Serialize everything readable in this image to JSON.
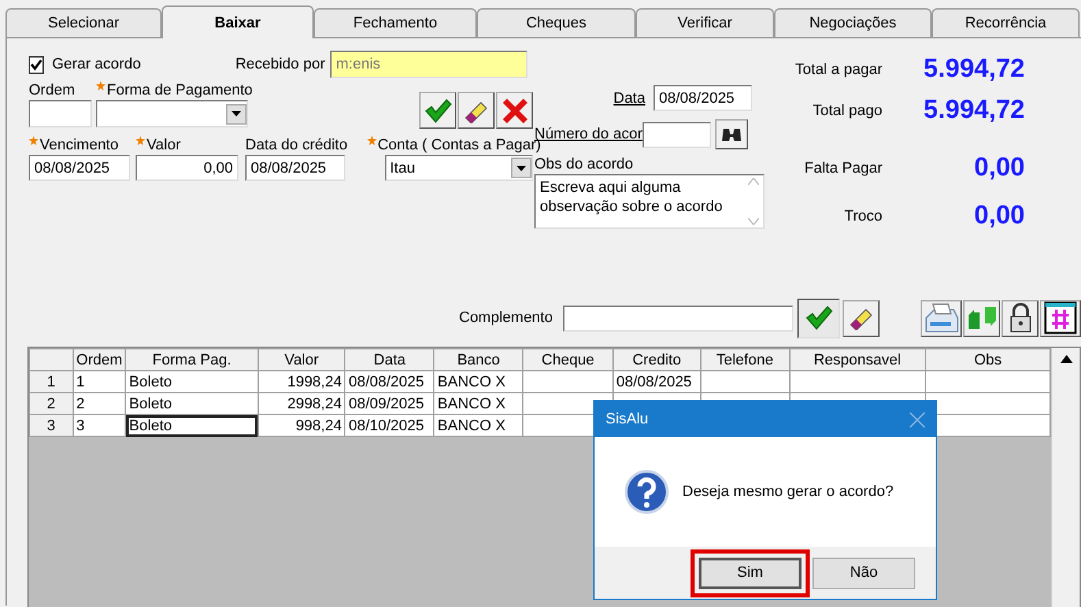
{
  "tabs": [
    {
      "label": "Selecionar",
      "selected": false
    },
    {
      "label": "Baixar",
      "selected": true
    },
    {
      "label": "Fechamento",
      "selected": false
    },
    {
      "label": "Cheques",
      "selected": false
    },
    {
      "label": "Verificar",
      "selected": false
    },
    {
      "label": "Negociações",
      "selected": false
    },
    {
      "label": "Recorrência",
      "selected": false
    }
  ],
  "gerar_acordo": {
    "label": "Gerar acordo",
    "checked": true
  },
  "recebido_por": {
    "label": "Recebido por",
    "value": "m:enis"
  },
  "ordem": {
    "label": "Ordem",
    "required": false
  },
  "forma_pagamento": {
    "label": "Forma de Pagamento",
    "required": true
  },
  "vencimento": {
    "label": "Vencimento",
    "required": true,
    "value": "08/08/2025"
  },
  "valor": {
    "label": "Valor",
    "required": true,
    "value": "0,00"
  },
  "data_credito": {
    "label": "Data do crédito",
    "required": false,
    "value": "08/08/2025"
  },
  "conta": {
    "label": "Conta ( Contas a Pagar)",
    "required": true,
    "value": "Itau"
  },
  "data": {
    "label": "Data",
    "value": "08/08/2025"
  },
  "numero_acordo": {
    "label": "Número do acor"
  },
  "obs_acordo": {
    "label": "Obs do acordo",
    "value": "Escreva aqui alguma observação sobre o acordo"
  },
  "totals": [
    {
      "label": "Total a pagar",
      "value": "5.994,72"
    },
    {
      "label": "Total pago",
      "value": "5.994,72"
    },
    {
      "label": "Falta Pagar",
      "value": "0,00"
    },
    {
      "label": "Troco",
      "value": "0,00"
    }
  ],
  "complemento": {
    "label": "Complemento"
  },
  "table": {
    "columns": [
      "Ordem",
      "Forma Pag.",
      "Valor",
      "Data",
      "Banco",
      "Cheque",
      "Credito",
      "Telefone",
      "Responsavel",
      "Obs"
    ],
    "rows": [
      {
        "number": "1",
        "cells": [
          "1",
          "Boleto",
          "1998,24",
          "08/08/2025",
          "BANCO X",
          "",
          "08/08/2025",
          "",
          "",
          ""
        ],
        "selected": false
      },
      {
        "number": "2",
        "cells": [
          "2",
          "Boleto",
          "2998,24",
          "08/09/2025",
          "BANCO X",
          "",
          "",
          "",
          "",
          ""
        ],
        "selected": false
      },
      {
        "number": "3",
        "cells": [
          "3",
          "Boleto",
          "998,24",
          "08/10/2025",
          "BANCO X",
          "",
          "",
          "",
          "",
          ""
        ],
        "selected": true
      }
    ]
  },
  "dialog": {
    "title": "SisAlu",
    "message": "Deseja mesmo gerar o acordo?",
    "buttons": [
      {
        "label": "Sim",
        "highlighted": true
      },
      {
        "label": "Não",
        "highlighted": false
      }
    ]
  }
}
